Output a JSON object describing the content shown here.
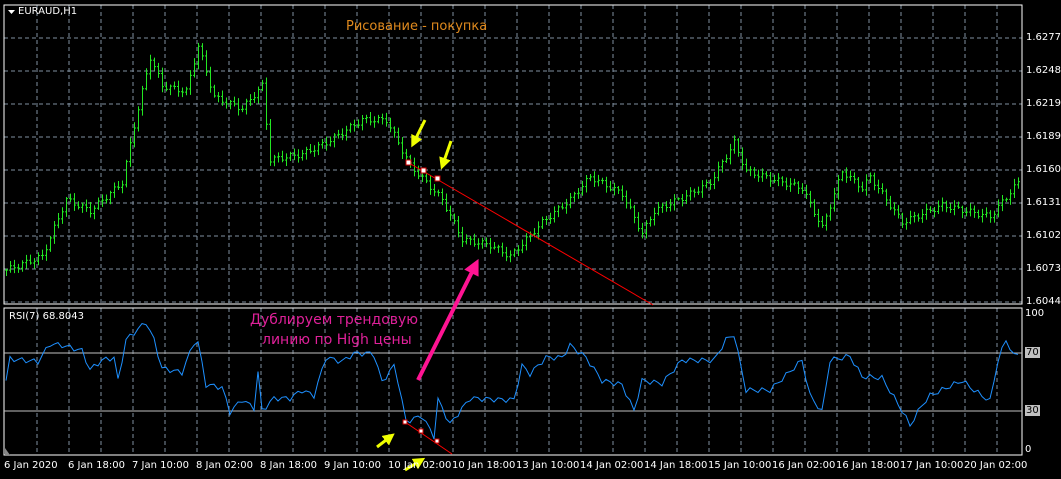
{
  "symbol": "EURAUD,H1",
  "chart_title": "Рисование - покупка",
  "annotation_lines": [
    "Дублируем трендовую",
    "линию по High цены"
  ],
  "indicator_label": "RSI(7) 68.8043",
  "colors": {
    "bars": "#22e622",
    "rsi": "#1e90ff",
    "trendline": "#ff0000",
    "arrow_yellow": "#f0ff00",
    "arrow_magenta": "#ff1493",
    "title": "#e08a1e",
    "annotation": "#e0209a",
    "grid": "#8090a0"
  },
  "price_axis": [
    "1.62770",
    "1.62480",
    "1.62190",
    "1.61895",
    "1.61605",
    "1.61315",
    "1.61025",
    "1.60730",
    "1.60440"
  ],
  "rsi_axis": {
    "top": "100",
    "upper": "70",
    "lower": "30",
    "bottom": "0"
  },
  "time_axis": [
    "6 Jan 2020",
    "6 Jan 18:00",
    "7 Jan 10:00",
    "8 Jan 02:00",
    "8 Jan 18:00",
    "9 Jan 10:00",
    "10 Jan 02:00",
    "10 Jan 18:00",
    "13 Jan 10:00",
    "14 Jan 02:00",
    "14 Jan 18:00",
    "15 Jan 10:00",
    "16 Jan 02:00",
    "16 Jan 18:00",
    "17 Jan 10:00",
    "20 Jan 02:00"
  ],
  "chart_data": {
    "type": "bar",
    "price_keypoints": [
      [
        0,
        1.6073
      ],
      [
        9,
        1.6085
      ],
      [
        15,
        1.6135
      ],
      [
        21,
        1.6125
      ],
      [
        29,
        1.615
      ],
      [
        32,
        1.62
      ],
      [
        36,
        1.626
      ],
      [
        39,
        1.6235
      ],
      [
        45,
        1.623
      ],
      [
        48,
        1.627
      ],
      [
        52,
        1.6225
      ],
      [
        59,
        1.6215
      ],
      [
        64,
        1.6235
      ],
      [
        66,
        1.617
      ],
      [
        74,
        1.6175
      ],
      [
        80,
        1.6185
      ],
      [
        89,
        1.6205
      ],
      [
        95,
        1.6205
      ],
      [
        101,
        1.6165
      ],
      [
        109,
        1.6135
      ],
      [
        114,
        1.61
      ],
      [
        121,
        1.6095
      ],
      [
        126,
        1.6085
      ],
      [
        134,
        1.6115
      ],
      [
        141,
        1.6135
      ],
      [
        146,
        1.6155
      ],
      [
        154,
        1.614
      ],
      [
        159,
        1.6105
      ],
      [
        162,
        1.6125
      ],
      [
        171,
        1.614
      ],
      [
        176,
        1.615
      ],
      [
        182,
        1.6185
      ],
      [
        185,
        1.616
      ],
      [
        199,
        1.6145
      ],
      [
        204,
        1.611
      ],
      [
        209,
        1.616
      ],
      [
        214,
        1.6145
      ],
      [
        216,
        1.6155
      ],
      [
        224,
        1.6115
      ],
      [
        234,
        1.613
      ],
      [
        246,
        1.612
      ],
      [
        253,
        1.615
      ]
    ],
    "rsi_keypoints": [
      [
        0,
        51
      ],
      [
        1,
        67
      ],
      [
        8,
        65
      ],
      [
        11,
        78
      ],
      [
        14,
        77
      ],
      [
        19,
        73
      ],
      [
        21,
        59
      ],
      [
        24,
        66
      ],
      [
        27,
        68
      ],
      [
        28,
        51
      ],
      [
        30,
        81
      ],
      [
        35,
        94
      ],
      [
        37,
        81
      ],
      [
        39,
        60
      ],
      [
        44,
        57
      ],
      [
        47,
        79
      ],
      [
        48,
        79
      ],
      [
        50,
        48
      ],
      [
        54,
        46
      ],
      [
        56,
        28
      ],
      [
        59,
        37
      ],
      [
        62,
        31
      ],
      [
        63,
        57
      ],
      [
        64,
        29
      ],
      [
        67,
        38
      ],
      [
        71,
        38
      ],
      [
        74,
        44
      ],
      [
        77,
        40
      ],
      [
        80,
        68
      ],
      [
        84,
        65
      ],
      [
        87,
        71
      ],
      [
        91,
        71
      ],
      [
        92,
        70
      ],
      [
        94,
        50
      ],
      [
        97,
        62
      ],
      [
        98,
        51
      ],
      [
        100,
        21
      ],
      [
        104,
        25
      ],
      [
        107,
        10
      ],
      [
        108,
        37
      ],
      [
        111,
        19
      ],
      [
        116,
        38
      ],
      [
        124,
        37
      ],
      [
        127,
        37
      ],
      [
        129,
        62
      ],
      [
        131,
        56
      ],
      [
        135,
        68
      ],
      [
        139,
        68
      ],
      [
        141,
        77
      ],
      [
        145,
        68
      ],
      [
        149,
        51
      ],
      [
        154,
        48
      ],
      [
        157,
        29
      ],
      [
        159,
        51
      ],
      [
        164,
        49
      ],
      [
        169,
        66
      ],
      [
        174,
        66
      ],
      [
        177,
        66
      ],
      [
        180,
        81
      ],
      [
        182,
        85
      ],
      [
        185,
        44
      ],
      [
        191,
        44
      ],
      [
        199,
        66
      ],
      [
        201,
        40
      ],
      [
        204,
        28
      ],
      [
        206,
        66
      ],
      [
        211,
        69
      ],
      [
        214,
        54
      ],
      [
        219,
        53
      ],
      [
        224,
        29
      ],
      [
        226,
        18
      ],
      [
        229,
        33
      ],
      [
        231,
        40
      ],
      [
        239,
        51
      ],
      [
        242,
        44
      ],
      [
        246,
        36
      ],
      [
        248,
        66
      ],
      [
        250,
        81
      ],
      [
        252,
        69
      ],
      [
        253,
        71
      ]
    ],
    "price_range": [
      1.6044,
      1.6277
    ],
    "rsi_levels": [
      30,
      70
    ]
  }
}
